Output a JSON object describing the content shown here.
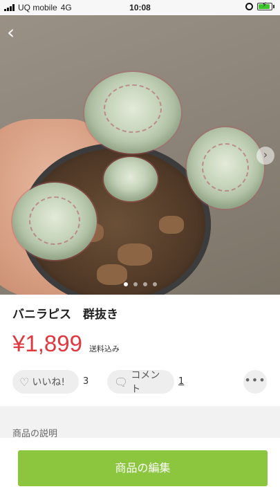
{
  "status_bar": {
    "carrier": "UQ mobile",
    "network": "4G",
    "time": "10:08",
    "battery_level": 0.9,
    "battery_color": "#3ec42f"
  },
  "header": {
    "back_icon": "chevron-left-icon",
    "back_glyph": "‹",
    "next_icon": "chevron-right-icon",
    "next_glyph": "›"
  },
  "gallery": {
    "image_description_icon": "product-photo",
    "page_count": 4,
    "active_page": 1
  },
  "product": {
    "title": "バニラピス　群抜き",
    "price": "¥1,899",
    "shipping": "送料込み"
  },
  "actions": {
    "like_label": "いいね!",
    "like_count": "3",
    "comment_label": "コメント",
    "comment_count": "1",
    "more_glyph": "•••"
  },
  "description": {
    "heading": "商品の説明"
  },
  "footer": {
    "edit_button": "商品の編集",
    "accent": "#8cc63f"
  },
  "colors": {
    "price": "#e0383e"
  }
}
